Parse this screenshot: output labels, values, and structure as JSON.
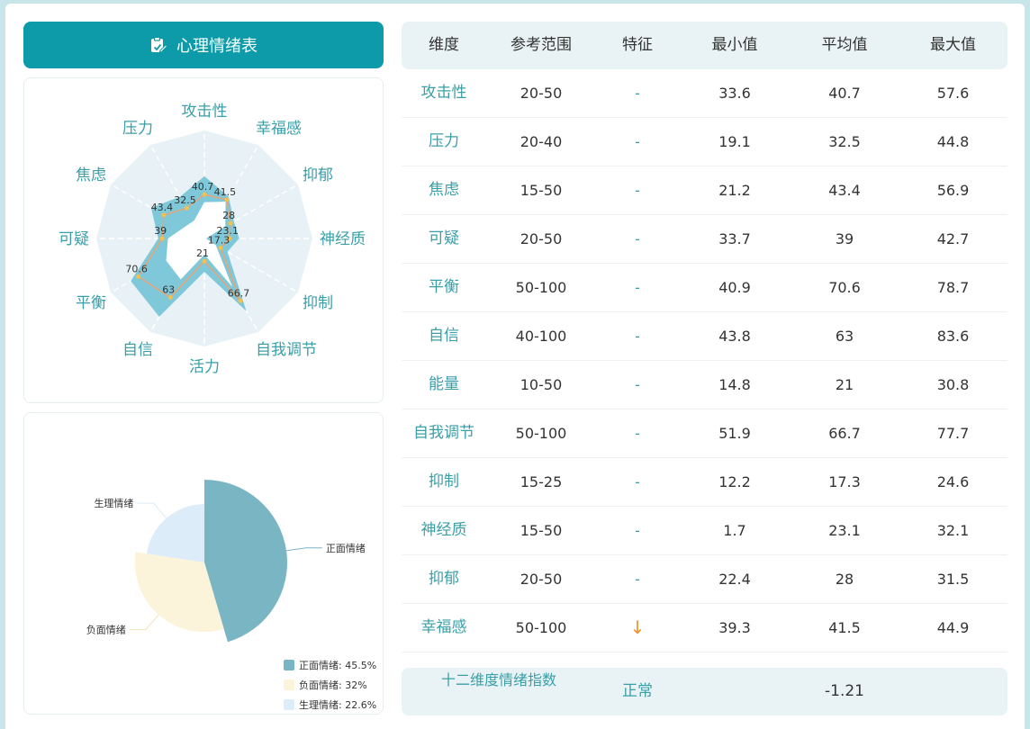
{
  "header": {
    "title": "心理情绪表",
    "icon": "edit-clipboard-icon",
    "accent": "#0d9ba9"
  },
  "table": {
    "headers": [
      "维度",
      "参考范围",
      "特征",
      "最小值",
      "平均值",
      "最大值"
    ],
    "rows": [
      {
        "dim": "攻击性",
        "range": "20-50",
        "feature": "-",
        "min": "33.6",
        "avg": "40.7",
        "max": "57.6"
      },
      {
        "dim": "压力",
        "range": "20-40",
        "feature": "-",
        "min": "19.1",
        "avg": "32.5",
        "max": "44.8"
      },
      {
        "dim": "焦虑",
        "range": "15-50",
        "feature": "-",
        "min": "21.2",
        "avg": "43.4",
        "max": "56.9"
      },
      {
        "dim": "可疑",
        "range": "20-50",
        "feature": "-",
        "min": "33.7",
        "avg": "39",
        "max": "42.7"
      },
      {
        "dim": "平衡",
        "range": "50-100",
        "feature": "-",
        "min": "40.9",
        "avg": "70.6",
        "max": "78.7"
      },
      {
        "dim": "自信",
        "range": "40-100",
        "feature": "-",
        "min": "43.8",
        "avg": "63",
        "max": "83.6"
      },
      {
        "dim": "能量",
        "range": "10-50",
        "feature": "-",
        "min": "14.8",
        "avg": "21",
        "max": "30.8"
      },
      {
        "dim": "自我调节",
        "range": "50-100",
        "feature": "-",
        "min": "51.9",
        "avg": "66.7",
        "max": "77.7"
      },
      {
        "dim": "抑制",
        "range": "15-25",
        "feature": "-",
        "min": "12.2",
        "avg": "17.3",
        "max": "24.6"
      },
      {
        "dim": "神经质",
        "range": "15-50",
        "feature": "-",
        "min": "1.7",
        "avg": "23.1",
        "max": "32.1"
      },
      {
        "dim": "抑郁",
        "range": "20-50",
        "feature": "-",
        "min": "22.4",
        "avg": "28",
        "max": "31.5"
      },
      {
        "dim": "幸福感",
        "range": "50-100",
        "feature": "↓",
        "min": "39.3",
        "avg": "41.5",
        "max": "44.9"
      }
    ],
    "summary": {
      "label": "十二维度情绪指数",
      "status": "正常",
      "value": "-1.21"
    }
  },
  "chart_data": [
    {
      "type": "radar",
      "indicators": [
        "攻击性",
        "幸福感",
        "抑郁",
        "神经质",
        "抑制",
        "自我调节",
        "活力",
        "自信",
        "平衡",
        "可疑",
        "焦虑",
        "压力"
      ],
      "max": 100,
      "series": [
        {
          "values": [
            57.6,
            44.9,
            31.5,
            32.1,
            24.6,
            77.7,
            30.8,
            83.6,
            78.7,
            42.7,
            56.9,
            44.8
          ],
          "color": "#7ec8d9",
          "area": true
        },
        {
          "values": [
            40.7,
            41.5,
            28,
            23.1,
            17.3,
            66.7,
            21,
            63,
            70.6,
            39,
            43.4,
            32.5
          ],
          "color": "#e8a477",
          "line": true,
          "labels": true
        },
        {
          "values": [
            33.6,
            39.3,
            22.4,
            1.7,
            12.2,
            51.9,
            14.8,
            43.8,
            40.9,
            33.7,
            21.2,
            19.1
          ],
          "color": "#ffffff",
          "area": true
        }
      ],
      "label_color": "#3a9fa8",
      "background": "#e8f2f6"
    },
    {
      "type": "pie",
      "rose": true,
      "slices": [
        {
          "name": "正面情绪",
          "value": 45.5,
          "color": "#7ab5c4",
          "legend": "正面情绪: 45.5%"
        },
        {
          "name": "负面情绪",
          "value": 32,
          "color": "#fbf4da",
          "legend": "负面情绪: 32%"
        },
        {
          "name": "生理情绪",
          "value": 22.6,
          "color": "#dcecf8",
          "legend": "生理情绪: 22.6%"
        }
      ],
      "legend_position": "bottom-right"
    }
  ]
}
